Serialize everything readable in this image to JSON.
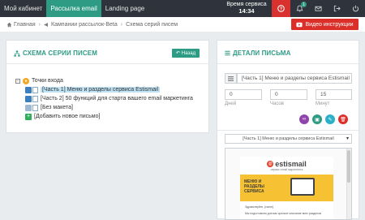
{
  "topnav": {
    "tabs": [
      {
        "label": "Мой кабинет",
        "active": false
      },
      {
        "label": "Рассылка email",
        "active": true
      },
      {
        "label": "Landing page",
        "active": false
      }
    ],
    "server_time_label": "Время сервиса",
    "server_time_value": "14:34",
    "notification_count": "1",
    "icons": [
      "help-icon",
      "bell-icon",
      "envelope-icon",
      "logout-icon",
      "power-icon"
    ],
    "accent_color": "#2e9b84",
    "help_color": "#d9322e"
  },
  "breadcrumb": {
    "items": [
      "Главная",
      "Кампании рассылок-Beta",
      "Схема серий писем"
    ]
  },
  "video_button": {
    "label": "Видео инструкции"
  },
  "left_panel": {
    "title": "СХЕМА СЕРИИ ПИСЕМ",
    "back_label": "Назад",
    "tree": {
      "root": "Точки входа",
      "items": [
        {
          "label": "[Часть 1] Меню и разделы сервиса Estismail",
          "selected": true
        },
        {
          "label": "[Часть 2] 50 функций для старта вашего email маркетинга",
          "selected": false
        },
        {
          "label": "[Без макета]",
          "selected": false
        },
        {
          "label": "[Добавить новое письмо]",
          "selected": false
        }
      ]
    }
  },
  "right_panel": {
    "title": "ДЕТАЛИ ПИСЬМА",
    "subject_value": "[Часть 1] Меню и разделы сервиса Estismail",
    "days_value": "0",
    "days_label": "Дней",
    "hours_value": "0",
    "hours_label": "Часов",
    "minutes_value": "15",
    "minutes_label": "Минут",
    "template_select": "[Часть 1] Меню и разделы сервиса Estismail",
    "preview": {
      "logo_text": "estismail",
      "tagline": "сервис email маркетинга",
      "hero_title_1": "МЕНЮ И",
      "hero_title_2": "РАЗДЕЛЫ",
      "hero_title_3": "СЕРВИСА",
      "greeting": "Здравствуйте, {name}",
      "body_line": "Мы подготовили для вас краткое описание всех разделов"
    }
  }
}
